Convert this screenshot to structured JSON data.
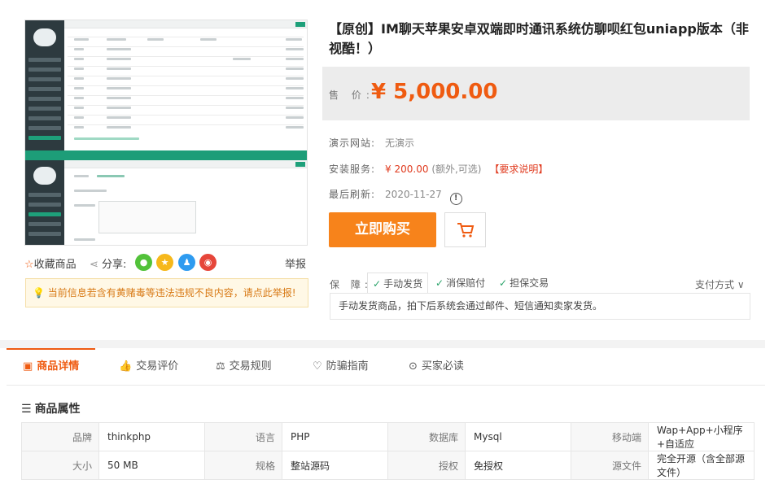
{
  "product": {
    "title": "【原创】IM聊天苹果安卓双端即时通讯系统仿聊呗红包uniapp版本（非视酷！）",
    "price_label": "售 价:",
    "price": "¥ 5,000.00"
  },
  "info": {
    "demo_label": "演示网站:",
    "demo_value": "无演示",
    "install_label": "安装服务:",
    "install_price": "¥ 200.00",
    "install_note": "(额外,可选)",
    "install_link": "【要求说明】",
    "refresh_label": "最后刷新:",
    "refresh_value": "2020-11-27"
  },
  "actions": {
    "buy_label": "立即购买",
    "collect_label": "收藏商品",
    "share_label": "分享:",
    "report_label": "举报"
  },
  "share_icons": [
    "wechat-icon",
    "qzone-icon",
    "qq-icon",
    "weibo-icon"
  ],
  "warning": "当前信息若含有黄赌毒等违法违规不良内容，请点此举报!",
  "guarantee": {
    "label": "保 障:",
    "items": [
      "手动发货",
      "消保赔付",
      "担保交易"
    ],
    "pay_label": "支付方式",
    "description": "手动发货商品，拍下后系统会通过邮件、短信通知卖家发货。"
  },
  "tabs": [
    "商品详情",
    "交易评价",
    "交易规则",
    "防骗指南",
    "买家必读"
  ],
  "attributes": {
    "title": "商品属性",
    "rows": [
      [
        [
          "品牌",
          "thinkphp"
        ],
        [
          "语言",
          "PHP"
        ],
        [
          "数据库",
          "Mysql"
        ],
        [
          "移动端",
          "Wap+App+小程序+自适应"
        ]
      ],
      [
        [
          "大小",
          "50 MB"
        ],
        [
          "规格",
          "整站源码"
        ],
        [
          "授权",
          "免授权"
        ],
        [
          "源文件",
          "完全开源（含全部源文件）"
        ]
      ]
    ]
  },
  "colors": {
    "accent": "#ef5b11",
    "buy_button": "#f7831b",
    "admin_sidebar": "#2d3a3f",
    "admin_green": "#1d9d78"
  }
}
